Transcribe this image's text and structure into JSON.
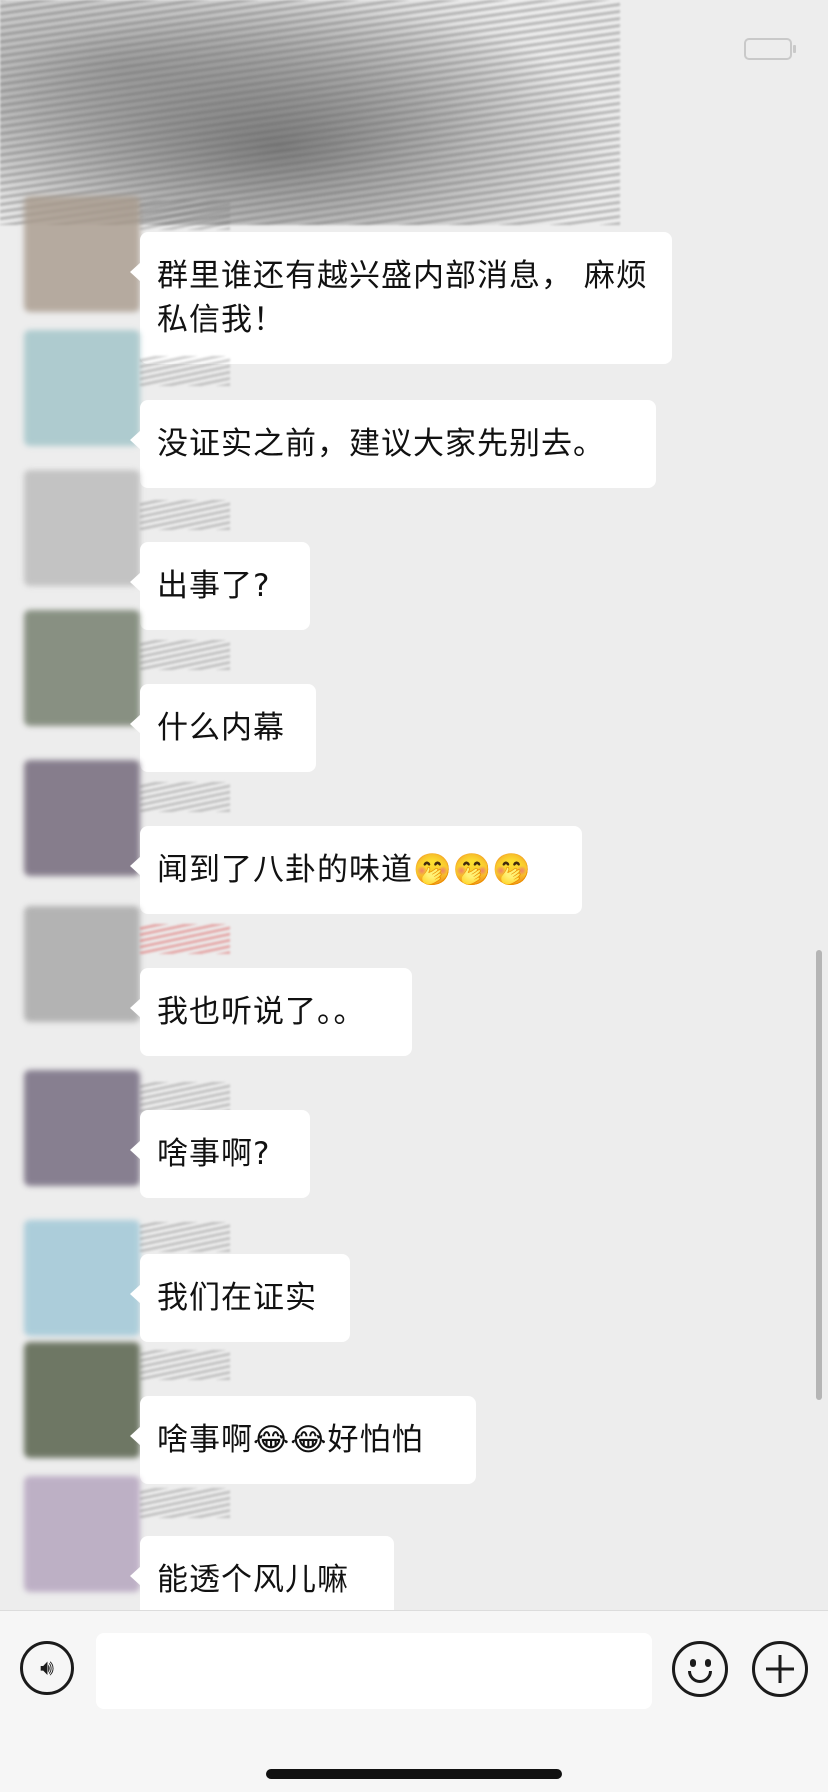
{
  "header": {
    "battery_icon": "battery-icon"
  },
  "messages": [
    {
      "text": "群里谁还有越兴盛内部消息， 麻烦私信我！",
      "avatar_color": "#a89a8c"
    },
    {
      "text": "没证实之前，建议大家先别去。",
      "avatar_color": "#9fc3c8"
    },
    {
      "text": "出事了?",
      "avatar_color": "#b9b9b9"
    },
    {
      "text": "什么内幕",
      "avatar_color": "#6f7a68"
    },
    {
      "text": "闻到了八卦的味道🤭🤭🤭",
      "avatar_color": "#6d6275"
    },
    {
      "text": "我也听说了。。",
      "avatar_color": "#a5a5a5"
    },
    {
      "text": "啥事啊?",
      "avatar_color": "#6e647a"
    },
    {
      "text": "我们在证实",
      "avatar_color": "#9cc6d6"
    },
    {
      "text": "啥事啊😂😂好怕怕",
      "avatar_color": "#4f5a43"
    },
    {
      "text": "能透个风儿嘛",
      "avatar_color": "#b2a1bc"
    }
  ],
  "input_bar": {
    "voice_icon": "voice-icon",
    "emoji_icon": "emoji-icon",
    "plus_icon": "plus-icon",
    "input_value": ""
  }
}
